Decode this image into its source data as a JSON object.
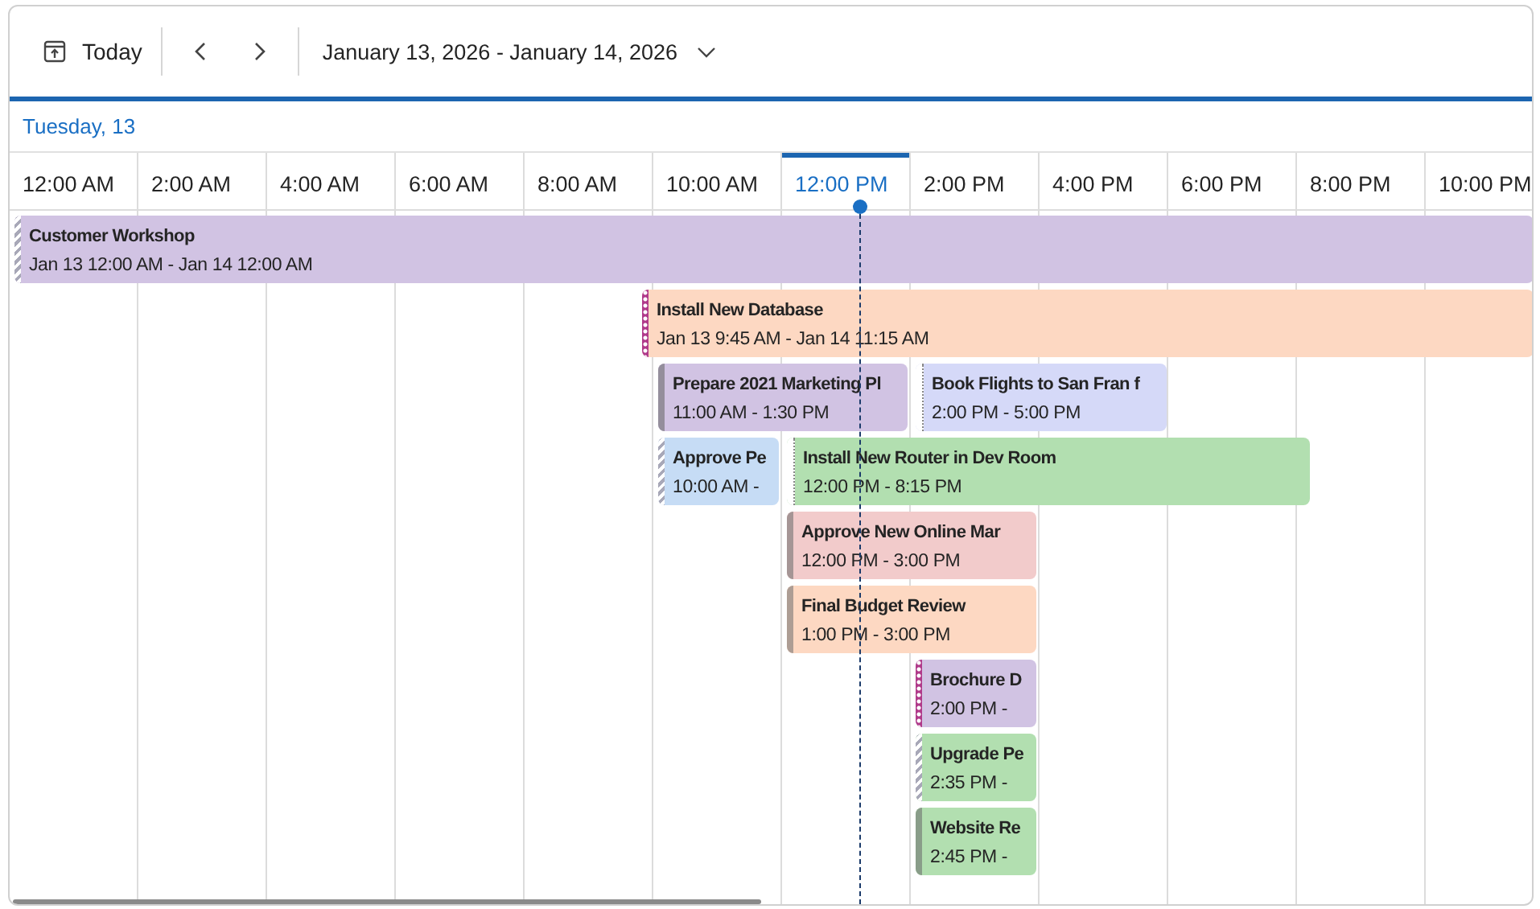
{
  "toolbar": {
    "today_button": "Today",
    "date_range": "January 13, 2026 - January 14, 2026"
  },
  "day_header": "Tuesday, 13",
  "time_slots": [
    {
      "label": "12:00 AM",
      "selected": false
    },
    {
      "label": "2:00 AM",
      "selected": false
    },
    {
      "label": "4:00 AM",
      "selected": false
    },
    {
      "label": "6:00 AM",
      "selected": false
    },
    {
      "label": "8:00 AM",
      "selected": false
    },
    {
      "label": "10:00 AM",
      "selected": false
    },
    {
      "label": "12:00 PM",
      "selected": true
    },
    {
      "label": "2:00 PM",
      "selected": false
    },
    {
      "label": "4:00 PM",
      "selected": false
    },
    {
      "label": "6:00 PM",
      "selected": false
    },
    {
      "label": "8:00 PM",
      "selected": false
    },
    {
      "label": "10:00 PM",
      "selected": false
    }
  ],
  "events": [
    {
      "title": "Customer Workshop",
      "time": "Jan 13 12:00 AM - Jan 14 12:00 AM",
      "color": "#d1c3e3",
      "kind": "tentative"
    },
    {
      "title": "Install New Database",
      "time": "Jan 13 9:45 AM - Jan 14 11:15 AM",
      "color": "#fdd8c2",
      "kind": "away"
    },
    {
      "title": "Prepare 2021 Marketing Pl",
      "time": "11:00 AM - 1:30 PM",
      "color": "#d1c3e3",
      "kind": "busy"
    },
    {
      "title": "Book Flights to San Fran f",
      "time": "2:00 PM - 5:00 PM",
      "color": "#d5d9f8",
      "kind": "free"
    },
    {
      "title": "Approve Pe",
      "time": "10:00 AM -",
      "color": "#c6dcf5",
      "kind": "tentative"
    },
    {
      "title": "Install New Router in Dev Room",
      "time": "12:00 PM - 8:15 PM",
      "color": "#b2dfb0",
      "kind": "free"
    },
    {
      "title": "Approve New Online Mar",
      "time": "12:00 PM - 3:00 PM",
      "color": "#f2cbcb",
      "kind": "busy"
    },
    {
      "title": "Final Budget Review",
      "time": "1:00 PM - 3:00 PM",
      "color": "#fdd8c2",
      "kind": "busy"
    },
    {
      "title": "Brochure D",
      "time": "2:00 PM -",
      "color": "#d1c3e3",
      "kind": "away"
    },
    {
      "title": "Upgrade Pe",
      "time": "2:35 PM -",
      "color": "#b2dfb0",
      "kind": "tentative"
    },
    {
      "title": "Website Re",
      "time": "2:45 PM -",
      "color": "#b2dfb0",
      "kind": "busy"
    }
  ]
}
